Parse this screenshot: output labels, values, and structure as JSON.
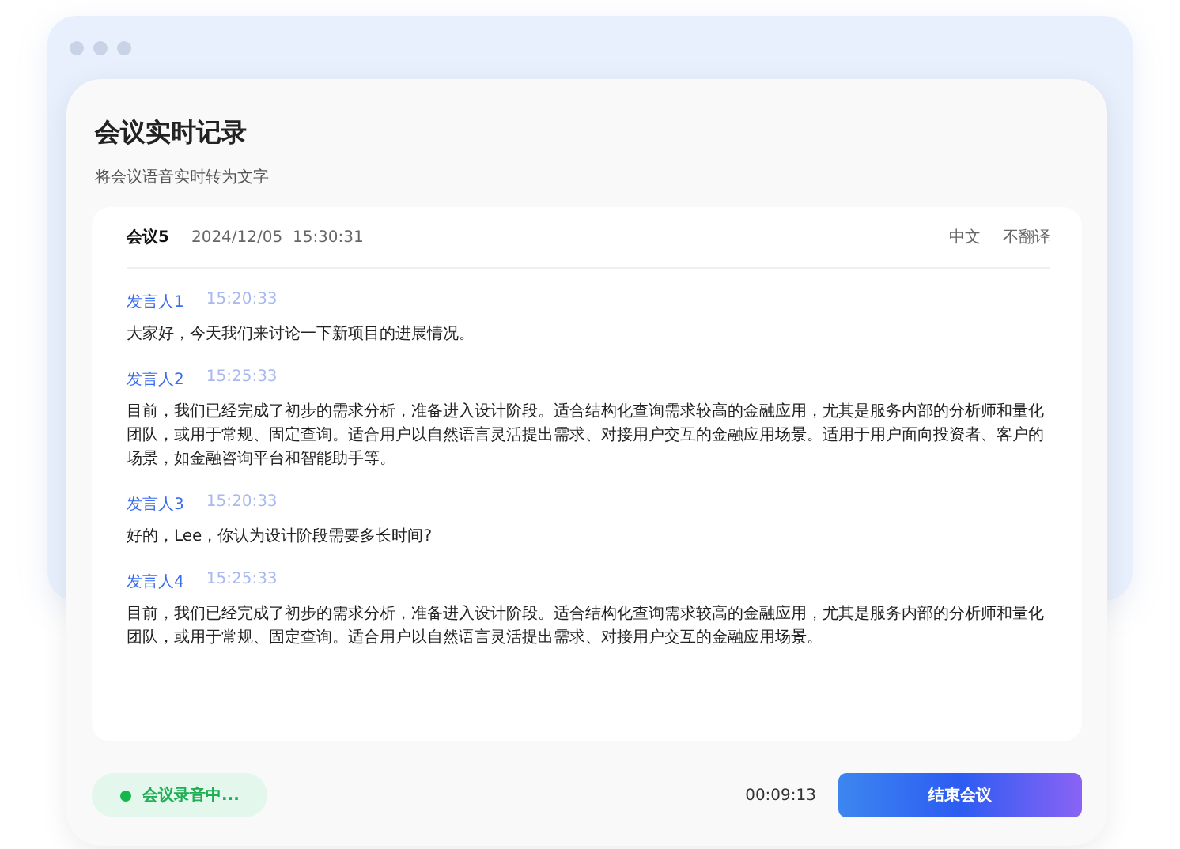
{
  "title": "会议实时记录",
  "subtitle": "将会议语音实时转为文字",
  "meeting": {
    "name": "会议5",
    "datetime": "2024/12/05  15:30:31",
    "language": "中文",
    "translation": "不翻译"
  },
  "entries": [
    {
      "speaker": "发言人1",
      "time": "15:20:33",
      "text": "大家好，今天我们来讨论一下新项目的进展情况。"
    },
    {
      "speaker": "发言人2",
      "time": "15:25:33",
      "text": "目前，我们已经完成了初步的需求分析，准备进入设计阶段。适合结构化查询需求较高的金融应用，尤其是服务内部的分析师和量化团队，或用于常规、固定查询。适合用户以自然语言灵活提出需求、对接用户交互的金融应用场景。适用于用户面向投资者、客户的场景，如金融咨询平台和智能助手等。"
    },
    {
      "speaker": "发言人3",
      "time": "15:20:33",
      "text": "好的，Lee，你认为设计阶段需要多长时间?"
    },
    {
      "speaker": "发言人4",
      "time": "15:25:33",
      "text": "目前，我们已经完成了初步的需求分析，准备进入设计阶段。适合结构化查询需求较高的金融应用，尤其是服务内部的分析师和量化团队，或用于常规、固定查询。适合用户以自然语言灵活提出需求、对接用户交互的金融应用场景。"
    }
  ],
  "status": {
    "label": "会议录音中...",
    "recording": true
  },
  "timer": "00:09:13",
  "end_button": "结束会议"
}
